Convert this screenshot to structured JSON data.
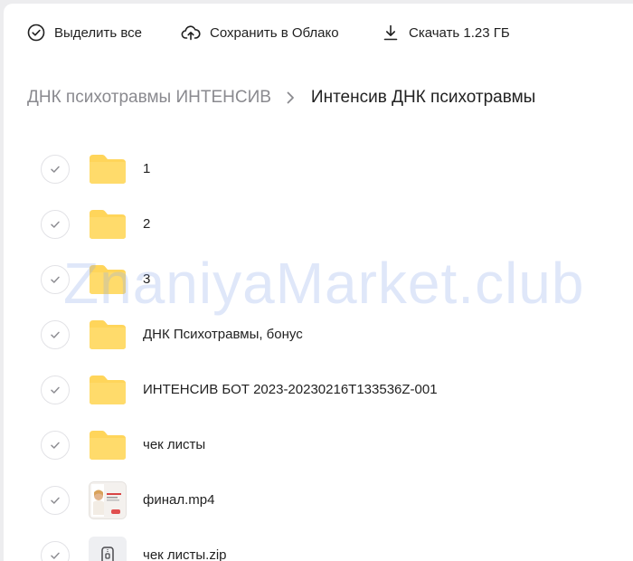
{
  "toolbar": {
    "select_all_label": "Выделить все",
    "save_cloud_label": "Сохранить в Облако",
    "download_label": "Скачать 1.23 ГБ"
  },
  "breadcrumb": {
    "parent": "ДНК психотравмы ИНТЕНСИВ",
    "current": "Интенсив ДНК психотравмы"
  },
  "files": [
    {
      "name": "1",
      "type": "folder"
    },
    {
      "name": "2",
      "type": "folder"
    },
    {
      "name": "3",
      "type": "folder"
    },
    {
      "name": "ДНК Психотравмы, бонус",
      "type": "folder"
    },
    {
      "name": "ИНТЕНСИВ БОТ 2023-20230216T133536Z-001",
      "type": "folder"
    },
    {
      "name": "чек листы",
      "type": "folder"
    },
    {
      "name": "финал.mp4",
      "type": "video"
    },
    {
      "name": "чек листы.zip",
      "type": "zip"
    }
  ],
  "watermark": "ZnaniyaMarket.club",
  "colors": {
    "folder": "#ffd55a",
    "folder_tab": "#f6c744",
    "muted_text": "#8a8a8f",
    "background": "#ededef"
  }
}
